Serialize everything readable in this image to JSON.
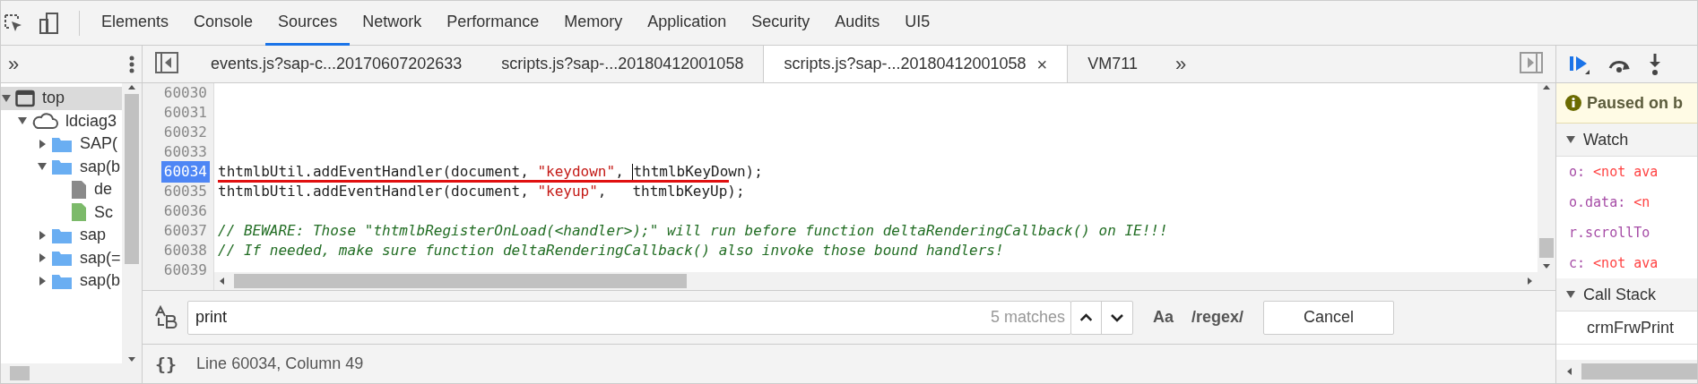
{
  "main_tabs": [
    {
      "label": "Elements",
      "selected": false
    },
    {
      "label": "Console",
      "selected": false
    },
    {
      "label": "Sources",
      "selected": true
    },
    {
      "label": "Network",
      "selected": false
    },
    {
      "label": "Performance",
      "selected": false
    },
    {
      "label": "Memory",
      "selected": false
    },
    {
      "label": "Application",
      "selected": false
    },
    {
      "label": "Security",
      "selected": false
    },
    {
      "label": "Audits",
      "selected": false
    },
    {
      "label": "UI5",
      "selected": false
    }
  ],
  "navigator": {
    "more": "»",
    "tree": [
      {
        "label": "top",
        "kind": "frame",
        "expanded": true,
        "selected": true,
        "children": [
          {
            "label": "ldciag3",
            "kind": "cloud",
            "expanded": true,
            "selected": false,
            "children": [
              {
                "label": "SAP(",
                "kind": "folder",
                "expanded": false,
                "selected": false
              },
              {
                "label": "sap(b",
                "kind": "folder",
                "expanded": true,
                "selected": false,
                "children": [
                  {
                    "label": "de",
                    "kind": "file",
                    "selected": false
                  },
                  {
                    "label": "Sc",
                    "kind": "script",
                    "selected": false
                  }
                ]
              },
              {
                "label": "sap",
                "kind": "folder",
                "expanded": false,
                "selected": false
              },
              {
                "label": "sap(=",
                "kind": "folder",
                "expanded": false,
                "selected": false
              },
              {
                "label": "sap(b",
                "kind": "folder",
                "expanded": false,
                "selected": false
              }
            ]
          }
        ]
      }
    ]
  },
  "file_tabs": [
    {
      "label": "events.js?sap-c...20170607202633",
      "selected": false
    },
    {
      "label": "scripts.js?sap-...20180412001058",
      "selected": false
    },
    {
      "label": "scripts.js?sap-...20180412001058",
      "selected": true,
      "close": "×"
    },
    {
      "label": "VM711",
      "selected": false
    }
  ],
  "file_tabs_more": "»",
  "code": [
    {
      "number": "60030",
      "selected": false,
      "underlined": false
    },
    {
      "number": "60031",
      "selected": false,
      "underlined": false
    },
    {
      "number": "60032",
      "selected": false,
      "underlined": false
    },
    {
      "number": "60033",
      "selected": false,
      "underlined": false
    },
    {
      "number": "60034",
      "selected": true,
      "underlined": true,
      "tokens": [
        {
          "kind": "plain",
          "text": "thtmlbUtil.addEventHandler(document, "
        },
        {
          "kind": "string",
          "text": "\"keydown\""
        },
        {
          "kind": "plain",
          "text": ", "
        },
        {
          "kind": "cursor"
        },
        {
          "kind": "plain",
          "text": "thtmlbKeyDown);"
        }
      ]
    },
    {
      "number": "60035",
      "selected": false,
      "underlined": false,
      "tokens": [
        {
          "kind": "plain",
          "text": "thtmlbUtil.addEventHandler(document, "
        },
        {
          "kind": "string",
          "text": "\"keyup\""
        },
        {
          "kind": "plain",
          "text": ",   thtmlbKeyUp);"
        }
      ]
    },
    {
      "number": "60036",
      "selected": false,
      "underlined": false
    },
    {
      "number": "60037",
      "selected": false,
      "underlined": false,
      "tokens": [
        {
          "kind": "comment",
          "text": "// BEWARE: Those \"thtmlbRegisterOnLoad(<handler>);\" will run before function deltaRenderingCallback() on IE!!!"
        }
      ]
    },
    {
      "number": "60038",
      "selected": false,
      "underlined": false,
      "tokens": [
        {
          "kind": "comment",
          "text": "// If needed, make sure function deltaRenderingCallback() also invoke those bound handlers!"
        }
      ]
    },
    {
      "number": "60039",
      "selected": false,
      "underlined": false
    }
  ],
  "search": {
    "value": "print",
    "matches": "5 matches",
    "case_toggle": "Aa",
    "regex_toggle": "/regex/",
    "cancel": "Cancel"
  },
  "status_bar": {
    "format_button": "{}",
    "position": "Line 60034, Column 49"
  },
  "debugger": {
    "paused": "Paused on b",
    "sections": [
      {
        "title": "Watch",
        "expanded": true,
        "kind": "watch",
        "items": [
          {
            "name": "o:",
            "value": "<not ava"
          },
          {
            "name": "o.data:",
            "value": "<n"
          },
          {
            "name": "r.scrollTo"
          },
          {
            "name": "c:",
            "value": "<not ava"
          }
        ]
      },
      {
        "title": "Call Stack",
        "expanded": true,
        "kind": "stack",
        "items": [
          {
            "name": "crmFrwPrint"
          }
        ]
      }
    ]
  }
}
